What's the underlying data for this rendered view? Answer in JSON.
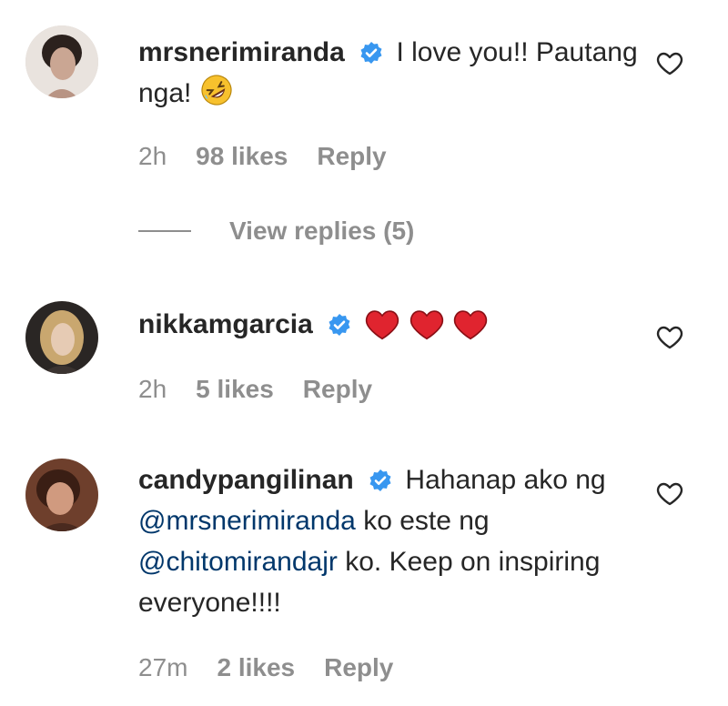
{
  "comments": [
    {
      "username": "mrsnerimiranda",
      "text": "I love you!! Pautang nga!",
      "emoji_icon": "rolling-on-floor-laughing-emoji",
      "time": "2h",
      "likes": "98 likes",
      "reply": "Reply",
      "view_replies": "View replies (5)"
    },
    {
      "username": "nikkamgarcia",
      "emoji_icon": "red-heart-emoji",
      "emoji_count": 3,
      "time": "2h",
      "likes": "5 likes",
      "reply": "Reply"
    },
    {
      "username": "candypangilinan",
      "text_a": "Hahanap ako ng",
      "mention_1": "@mrsnerimiranda",
      "text_b": "ko este ng",
      "mention_2": "@chitomirandajr",
      "text_c": "ko. Keep on inspiring everyone!!!!",
      "time": "27m",
      "likes": "2 likes",
      "reply": "Reply"
    }
  ],
  "colors": {
    "text": "#262626",
    "secondary": "#8e8e8e",
    "mention": "#00376b",
    "verified": "#3897f0",
    "heart": "#e0242f"
  }
}
